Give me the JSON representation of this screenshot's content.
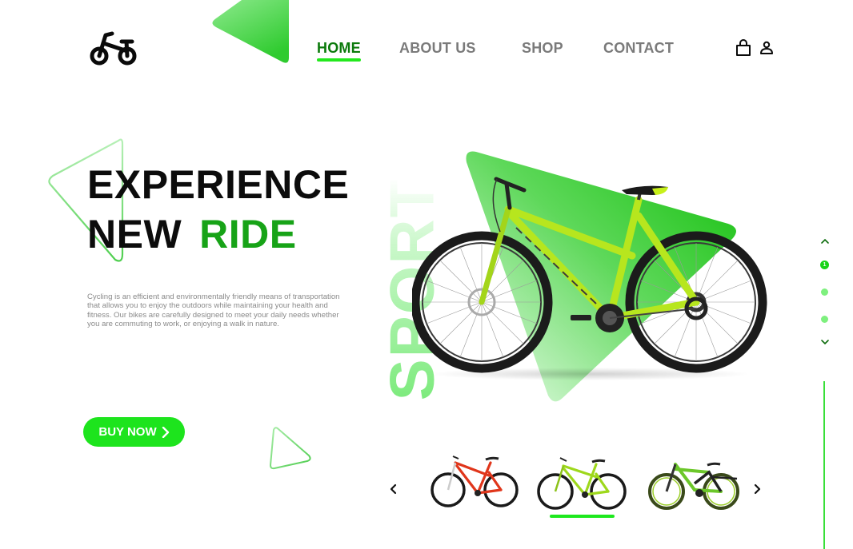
{
  "brand": {
    "logo_icon": "bicycle-icon",
    "accent_color": "#1de41d",
    "dark_green": "#0b7a0b",
    "headline_green": "#17a317"
  },
  "nav": {
    "items": [
      {
        "label": "HOME",
        "active": true
      },
      {
        "label": "ABOUT US",
        "active": false
      },
      {
        "label": "SHOP",
        "active": false
      },
      {
        "label": "CONTACT",
        "active": false
      }
    ],
    "icons": [
      "shopping-bag-icon",
      "user-icon"
    ]
  },
  "hero": {
    "headline_line1": "EXPERIENCE",
    "headline_line2_a": "NEW",
    "headline_line2_b": "RIDE",
    "description": "Cycling is an efficient and environmentally friendly means of transportation that allows you to enjoy the outdoors while maintaining your health and fitness. Our bikes are carefully designed to meet your daily needs whether you are commuting to work, or enjoying a walk in nature.",
    "cta_label": "BUY NOW",
    "cta_icon": "chevron-right-icon",
    "vertical_word": "SPORT",
    "featured_bike": "lime-green mountain bike"
  },
  "pager": {
    "current": "1",
    "total_dots": 3,
    "up_icon": "chevron-up-icon",
    "down_icon": "chevron-down-icon"
  },
  "carousel": {
    "prev_icon": "chevron-left-icon",
    "next_icon": "chevron-right-icon",
    "thumbnails": [
      {
        "name": "red mountain bike",
        "active": false
      },
      {
        "name": "lime mountain bike",
        "active": true
      },
      {
        "name": "green full-suspension bike",
        "active": false
      }
    ]
  }
}
